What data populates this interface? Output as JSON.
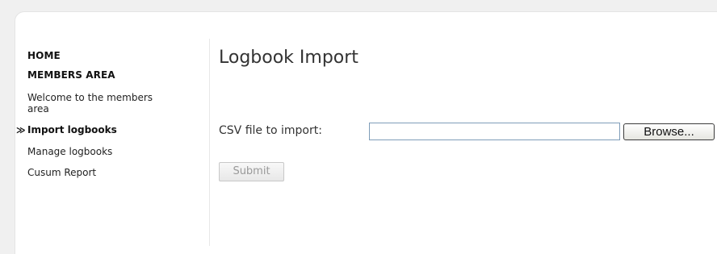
{
  "sidebar": {
    "home": "HOME",
    "members_area": "MEMBERS AREA",
    "items": [
      {
        "label": "Welcome to the members area",
        "active": false
      },
      {
        "label": "Import logbooks",
        "active": true
      },
      {
        "label": "Manage logbooks",
        "active": false
      },
      {
        "label": "Cusum Report",
        "active": false
      }
    ],
    "active_marker": "⋹"
  },
  "main": {
    "title": "Logbook Import",
    "csv_field": {
      "label": "CSV file to import:",
      "value": "",
      "browse_label": "Browse..."
    },
    "submit_label": "Submit"
  },
  "colors": {
    "input_border": "#7f9db9",
    "divider": "#e8e8e8",
    "background": "#f0f0f0"
  }
}
